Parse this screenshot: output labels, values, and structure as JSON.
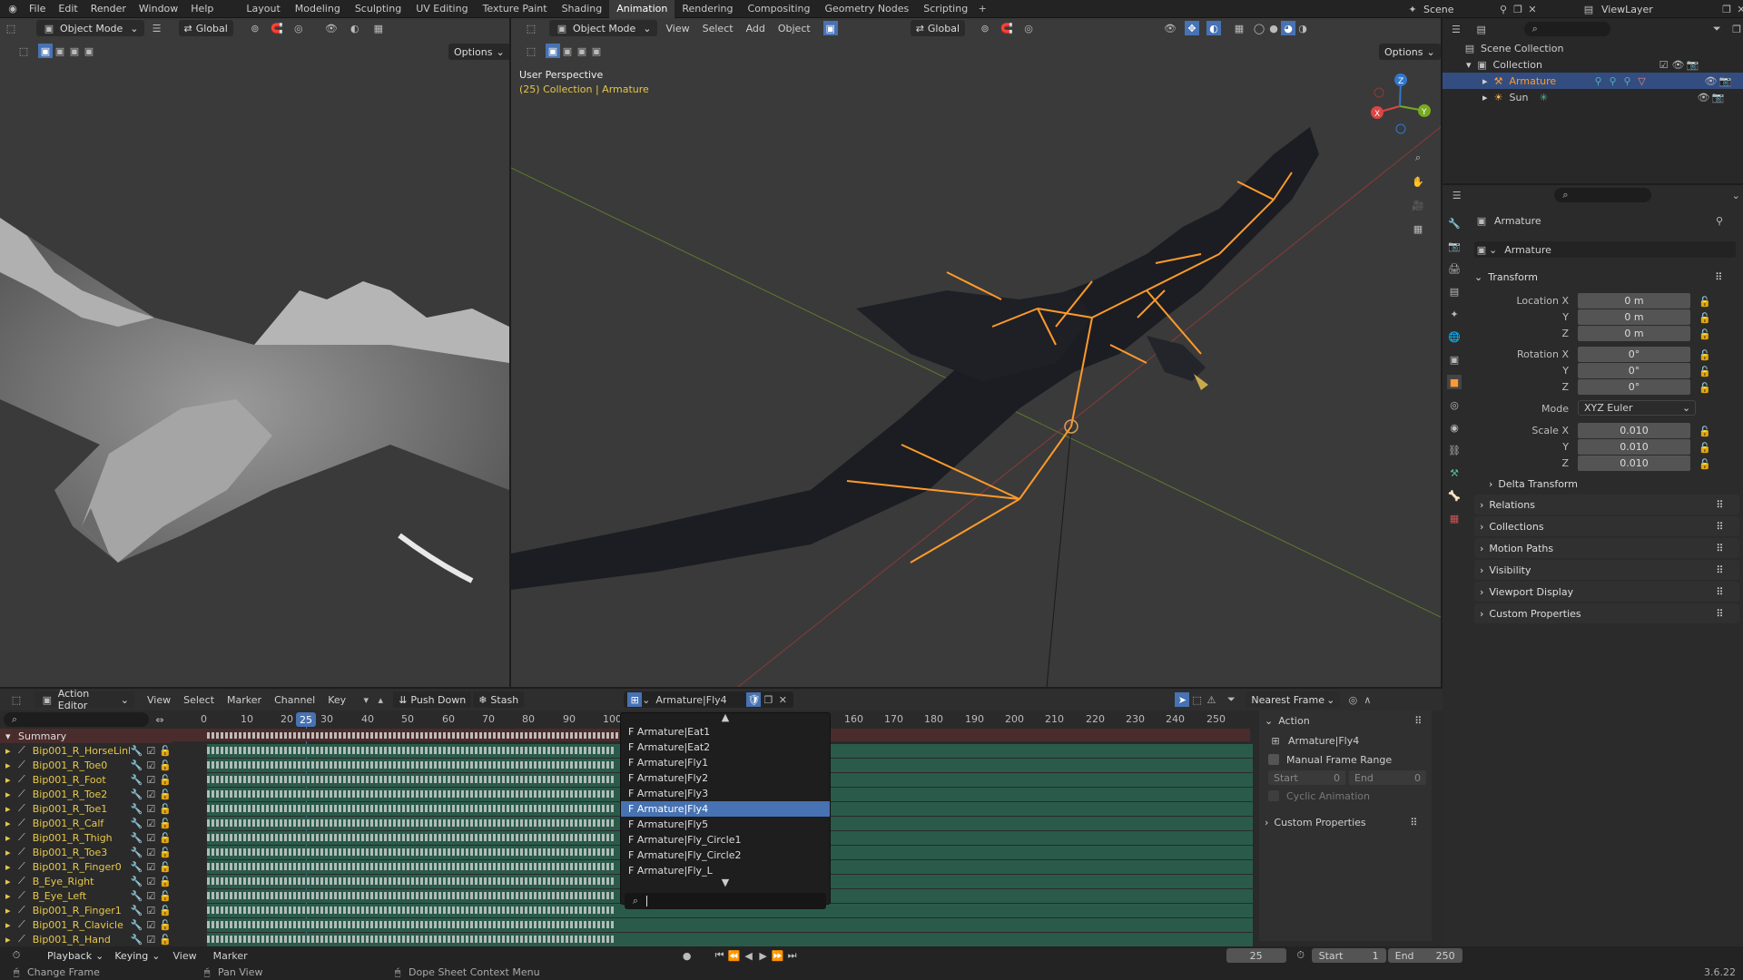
{
  "topbar": {
    "menus": [
      "File",
      "Edit",
      "Render",
      "Window",
      "Help"
    ],
    "workspaces": [
      "Layout",
      "Modeling",
      "Sculpting",
      "UV Editing",
      "Texture Paint",
      "Shading",
      "Animation",
      "Rendering",
      "Compositing",
      "Geometry Nodes",
      "Scripting"
    ],
    "active_workspace": "Animation",
    "scene": "Scene",
    "view_layer": "ViewLayer"
  },
  "viewport_left": {
    "mode": "Object Mode",
    "orientation": "Global",
    "options": "Options"
  },
  "viewport_right": {
    "mode": "Object Mode",
    "menus": [
      "View",
      "Select",
      "Add",
      "Object"
    ],
    "orientation": "Global",
    "options": "Options",
    "perspective": "User Perspective",
    "collection_info": "(25) Collection | Armature",
    "axis_x": "X",
    "axis_y": "Y",
    "axis_z": "Z"
  },
  "outliner": {
    "root": "Scene Collection",
    "collection": "Collection",
    "items": [
      {
        "name": "Armature",
        "selected": true
      },
      {
        "name": "Sun",
        "selected": false
      }
    ]
  },
  "properties": {
    "object_name": "Armature",
    "datablock": "Armature",
    "transform_title": "Transform",
    "location_label": "Location X",
    "y_label": "Y",
    "z_label": "Z",
    "location": [
      "0 m",
      "0 m",
      "0 m"
    ],
    "rotation_label": "Rotation X",
    "rotation": [
      "0°",
      "0°",
      "0°"
    ],
    "mode_label": "Mode",
    "mode_value": "XYZ Euler",
    "scale_label": "Scale X",
    "scale": [
      "0.010",
      "0.010",
      "0.010"
    ],
    "delta_transform": "Delta Transform",
    "sections": [
      "Relations",
      "Collections",
      "Motion Paths",
      "Visibility",
      "Viewport Display",
      "Custom Properties"
    ]
  },
  "action_editor": {
    "editor": "Action Editor",
    "menus": [
      "View",
      "Select",
      "Marker",
      "Channel",
      "Key"
    ],
    "push_down": "Push Down",
    "stash": "Stash",
    "action_name": "Armature|Fly4",
    "snap_mode": "Nearest Frame",
    "current_frame": "25",
    "ruler": [
      "0",
      "10",
      "20",
      "30",
      "40",
      "50",
      "60",
      "70",
      "80",
      "90",
      "100",
      "160",
      "170",
      "180",
      "190",
      "200",
      "210",
      "220",
      "230",
      "240",
      "250"
    ],
    "channels": [
      "Summary",
      "Bip001_R_HorseLink",
      "Bip001_R_Toe0",
      "Bip001_R_Foot",
      "Bip001_R_Toe2",
      "Bip001_R_Toe1",
      "Bip001_R_Calf",
      "Bip001_R_Thigh",
      "Bip001_R_Toe3",
      "Bip001_R_Finger0",
      "B_Eye_Right",
      "B_Eye_Left",
      "Bip001_R_Finger1",
      "Bip001_R_Clavicle",
      "Bip001_R_Hand"
    ],
    "dropdown_items": [
      "F Armature|Eat1",
      "F Armature|Eat2",
      "F Armature|Fly1",
      "F Armature|Fly2",
      "F Armature|Fly3",
      "F Armature|Fly4",
      "F Armature|Fly5",
      "F Armature|Fly_Circle1",
      "F Armature|Fly_Circle2",
      "F Armature|Fly_L"
    ],
    "dropdown_selected": "F Armature|Fly4",
    "side_action_title": "Action",
    "side_action_name": "Armature|Fly4",
    "manual_frame_range": "Manual Frame Range",
    "start_label": "Start",
    "start_value": "0",
    "end_label": "End",
    "end_value": "0",
    "cyclic": "Cyclic Animation",
    "custom_props": "Custom Properties"
  },
  "timeline": {
    "playback": "Playback",
    "keying": "Keying",
    "view": "View",
    "marker": "Marker",
    "frame": "25",
    "start_label": "Start",
    "start": "1",
    "end_label": "End",
    "end": "250"
  },
  "status": {
    "left": "Change Frame",
    "mid": "Pan View",
    "right": "Dope Sheet Context Menu",
    "version": "3.6.22"
  },
  "colors": {
    "accent": "#4772b3",
    "bone": "#ff9a2a",
    "channel_text": "#e7c84a",
    "key_row": "#2a5a4a"
  }
}
